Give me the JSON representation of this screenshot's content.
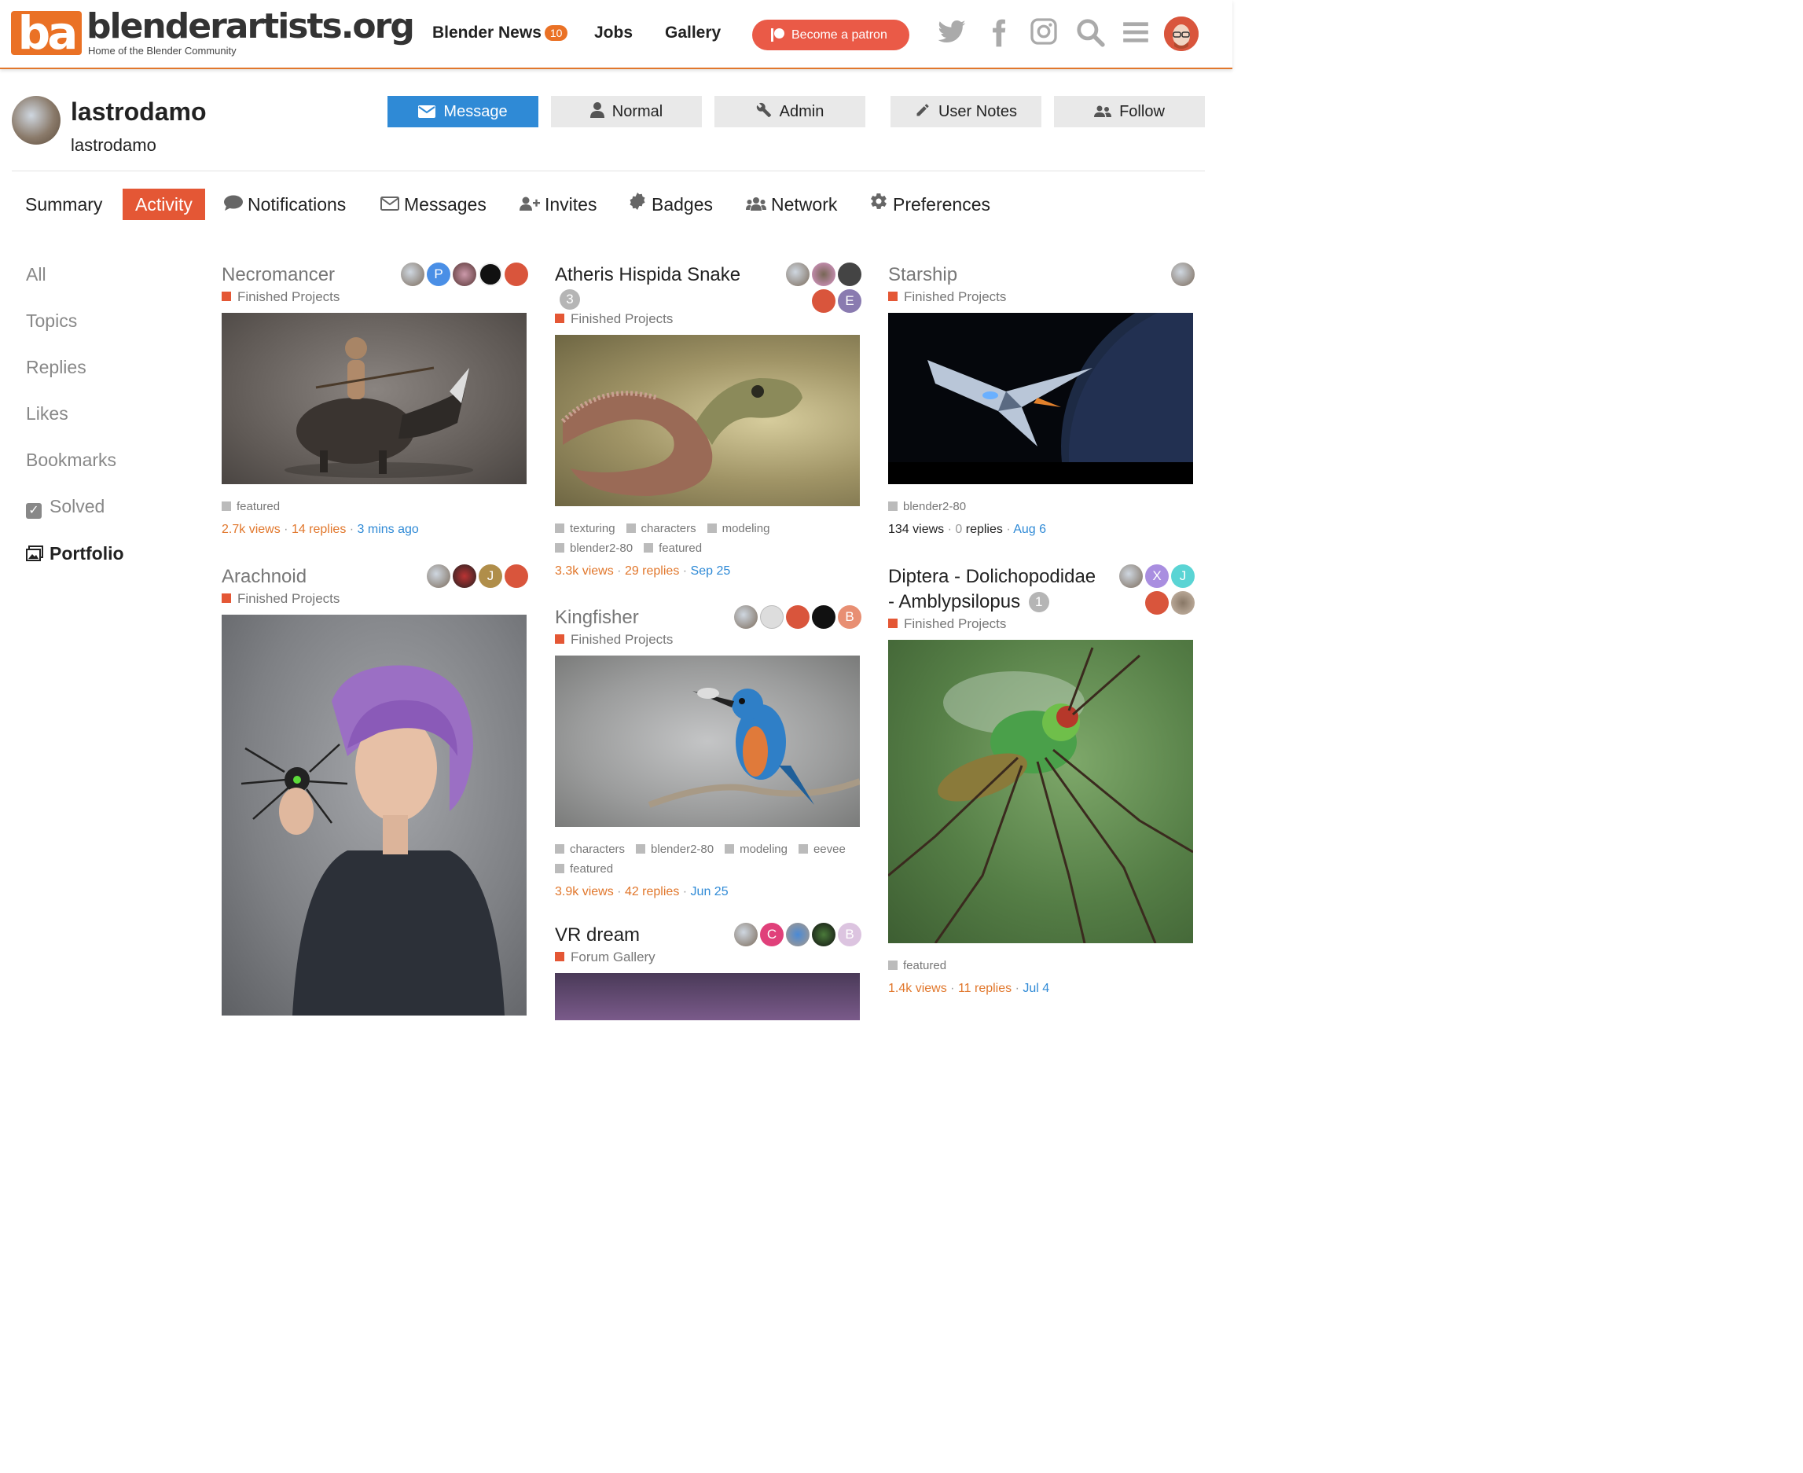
{
  "header": {
    "logo_mark": "ba",
    "logo_text": "blenderartists.org",
    "logo_tagline": "Home of the Blender Community",
    "nav": {
      "news": "Blender News",
      "news_count": "10",
      "jobs": "Jobs",
      "gallery": "Gallery"
    },
    "patron_label": "Become a patron"
  },
  "profile": {
    "name": "lastrodamo",
    "username": "lastrodamo",
    "buttons": {
      "message": "Message",
      "normal": "Normal",
      "admin": "Admin",
      "user_notes": "User Notes",
      "follow": "Follow"
    }
  },
  "tabs": {
    "summary": "Summary",
    "activity": "Activity",
    "notifications": "Notifications",
    "messages": "Messages",
    "invites": "Invites",
    "badges": "Badges",
    "network": "Network",
    "preferences": "Preferences"
  },
  "left_nav": {
    "all": "All",
    "topics": "Topics",
    "replies": "Replies",
    "likes": "Likes",
    "bookmarks": "Bookmarks",
    "solved": "Solved",
    "portfolio": "Portfolio"
  },
  "colors": {
    "accent": "#e45735",
    "brand_orange": "#ea7125",
    "link_blue": "#2f8ad6"
  },
  "cards": {
    "necromancer": {
      "title": "Necromancer",
      "category": "Finished Projects",
      "tags": [
        "featured"
      ],
      "views": "2.7k views",
      "replies": "14 replies",
      "date": "3 mins ago",
      "avatar_letters": [
        "P"
      ]
    },
    "arachnoid": {
      "title": "Arachnoid",
      "category": "Finished Projects",
      "avatar_letters": [
        "J"
      ]
    },
    "atheris": {
      "title": "Atheris Hispida Snake",
      "reply_count": "3",
      "category": "Finished Projects",
      "tags": [
        "texturing",
        "characters",
        "modeling",
        "blender2-80",
        "featured"
      ],
      "views": "3.3k views",
      "replies": "29 replies",
      "date": "Sep 25",
      "avatar_letters": [
        "E"
      ]
    },
    "kingfisher": {
      "title": "Kingfisher",
      "category": "Finished Projects",
      "tags": [
        "characters",
        "blender2-80",
        "modeling",
        "eevee",
        "featured"
      ],
      "views": "3.9k views",
      "replies": "42 replies",
      "date": "Jun 25",
      "avatar_letters": [
        "B"
      ]
    },
    "vrdream": {
      "title": "VR dream",
      "category": "Forum Gallery",
      "avatar_letters": [
        "C",
        "B"
      ]
    },
    "starship": {
      "title": "Starship",
      "category": "Finished Projects",
      "tags": [
        "blender2-80"
      ],
      "views": "134 views",
      "replies_num": "0",
      "replies_word": "replies",
      "date": "Aug 6"
    },
    "diptera": {
      "title_line1": "Diptera - Dolichopodidae",
      "title_line2": "- Amblypsilopus",
      "reply_count": "1",
      "category": "Finished Projects",
      "tags": [
        "featured"
      ],
      "views": "1.4k views",
      "replies": "11 replies",
      "date": "Jul 4",
      "avatar_letters": [
        "X",
        "J"
      ]
    }
  }
}
